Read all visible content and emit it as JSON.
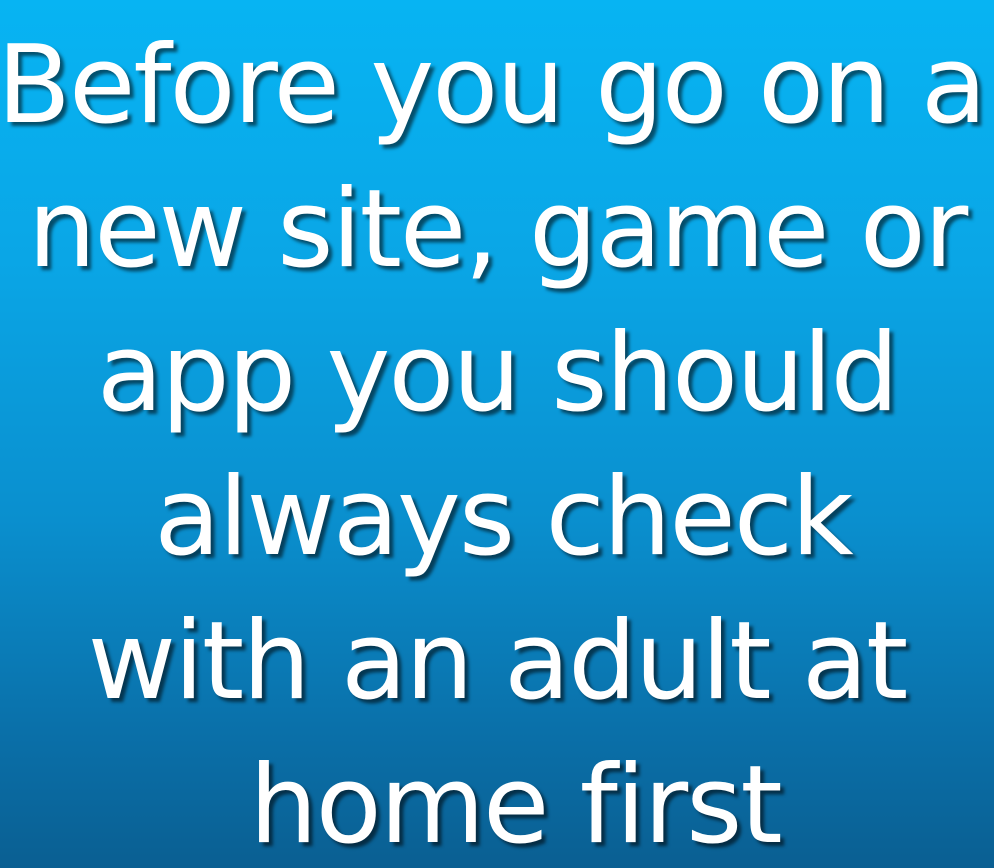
{
  "slide": {
    "background_colors": [
      "#07b4f3",
      "#0a5f92"
    ],
    "text_color": "#ffffff",
    "lines": [
      "Before you go on a",
      "new site, game or",
      "app you should",
      "always check",
      "with an adult at",
      "home first"
    ]
  }
}
